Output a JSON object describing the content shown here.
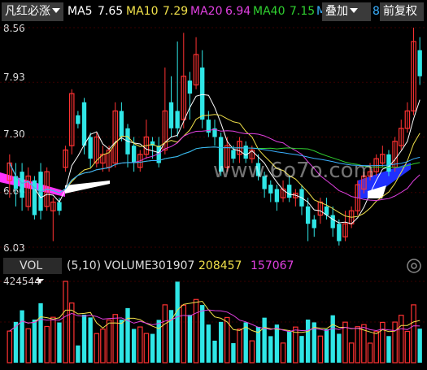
{
  "header": {
    "indicator_label": "凡红必涨",
    "ma5_label": "MA5",
    "ma5_value": "7.65",
    "ma10_label": "MA10",
    "ma10_value": "7.29",
    "ma20_label": "MA20",
    "ma20_value": "6.94",
    "ma40_label": "MA40",
    "ma40_value": "7.15",
    "ma60_label": "M",
    "overlay_button": "叠加",
    "adjust_button": "前复权",
    "extra_digit": "8"
  },
  "price_axis": {
    "top": "8.56",
    "mid1": "7.93",
    "mid2": "7.30",
    "mid3": "6.66",
    "bottom": "6.03"
  },
  "watermark": "www.6o7o.com",
  "volume_panel": {
    "selector": "VOL",
    "params": "(5,10)",
    "volume_label": "VOLUME",
    "volume_value": "301907",
    "ma5_value": "208457",
    "ma10_value": "157067",
    "axis_top": "424544"
  },
  "colors": {
    "up": "#ff3232",
    "down": "#2fe6e6",
    "ma5": "#ffffff",
    "ma10": "#f0e04a",
    "ma20": "#e040e0",
    "ma40": "#30d030",
    "ma60": "#3ab0ff",
    "accent_magenta": "#ff33ff"
  },
  "icons": {
    "settings": "gear-icon",
    "dropdown": "chevron-down-icon"
  }
}
